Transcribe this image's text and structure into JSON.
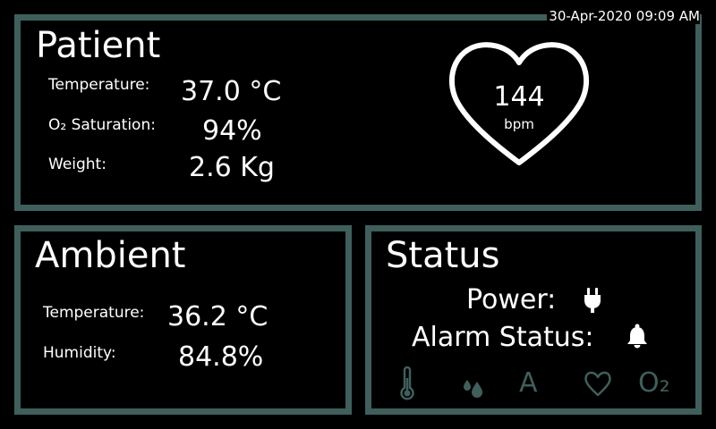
{
  "header": {
    "datetime": "30-Apr-2020 09:09 AM"
  },
  "patient": {
    "title": "Patient",
    "temperature_label": "Temperature:",
    "temperature_value": "37.0 °C",
    "o2_label": "O₂ Saturation:",
    "o2_value": "94%",
    "weight_label": "Weight:",
    "weight_value": "2.6 Kg",
    "heart_rate_value": "144",
    "heart_rate_unit": "bpm"
  },
  "ambient": {
    "title": "Ambient",
    "temperature_label": "Temperature:",
    "temperature_value": "36.2 °C",
    "humidity_label": "Humidity:",
    "humidity_value": "84.8%"
  },
  "status": {
    "title": "Status",
    "power_label": "Power:",
    "power_icon": "plug-icon",
    "alarm_label": "Alarm Status:",
    "alarm_icon": "bell-icon",
    "indicators": {
      "temperature_icon": "thermometer-icon",
      "humidity_icon": "droplets-icon",
      "a_text": "A",
      "heart_icon": "heart-icon",
      "o2_text": "O₂"
    }
  },
  "colors": {
    "background": "#000000",
    "panel_border": "#3f5f5c",
    "text": "#ffffff",
    "indicator_inactive": "#3f5f5c"
  }
}
